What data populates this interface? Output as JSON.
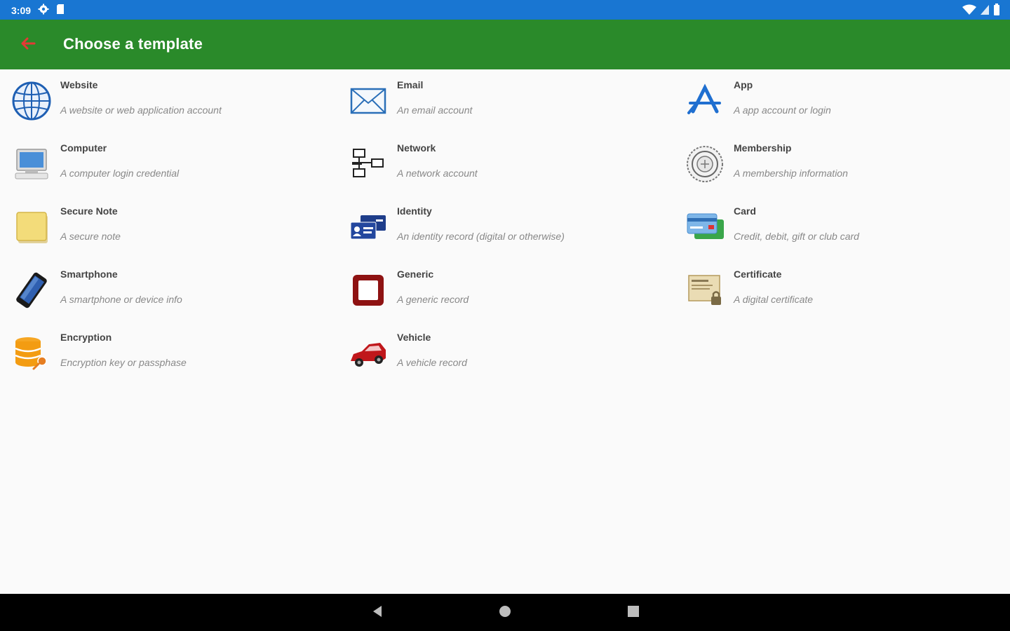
{
  "status_bar": {
    "time": "3:09"
  },
  "app_bar": {
    "title": "Choose a template"
  },
  "colors": {
    "status_bar": "#1976d2",
    "app_bar": "#2a8a2a",
    "back_arrow": "#e53935",
    "nav_bar": "#000000"
  },
  "templates": [
    {
      "name": "Website",
      "desc": "A website or web application account",
      "icon": "globe-icon"
    },
    {
      "name": "Email",
      "desc": "An email account",
      "icon": "envelope-icon"
    },
    {
      "name": "App",
      "desc": "A app account or login",
      "icon": "app-store-icon"
    },
    {
      "name": "Computer",
      "desc": "A computer login credential",
      "icon": "computer-icon"
    },
    {
      "name": "Network",
      "desc": "A network account",
      "icon": "network-icon"
    },
    {
      "name": "Membership",
      "desc": "A membership information",
      "icon": "membership-seal-icon"
    },
    {
      "name": "Secure Note",
      "desc": "A secure note",
      "icon": "sticky-note-icon"
    },
    {
      "name": "Identity",
      "desc": "An identity record (digital or otherwise)",
      "icon": "id-cards-icon"
    },
    {
      "name": "Card",
      "desc": "Credit, debit, gift or club card",
      "icon": "credit-cards-icon"
    },
    {
      "name": "Smartphone",
      "desc": "A smartphone or device info",
      "icon": "smartphone-icon"
    },
    {
      "name": "Generic",
      "desc": "A generic record",
      "icon": "generic-square-icon"
    },
    {
      "name": "Certificate",
      "desc": "A digital certificate",
      "icon": "certificate-icon"
    },
    {
      "name": "Encryption",
      "desc": "Encryption key or passphase",
      "icon": "database-key-icon"
    },
    {
      "name": "Vehicle",
      "desc": "A vehicle record",
      "icon": "car-icon"
    }
  ]
}
